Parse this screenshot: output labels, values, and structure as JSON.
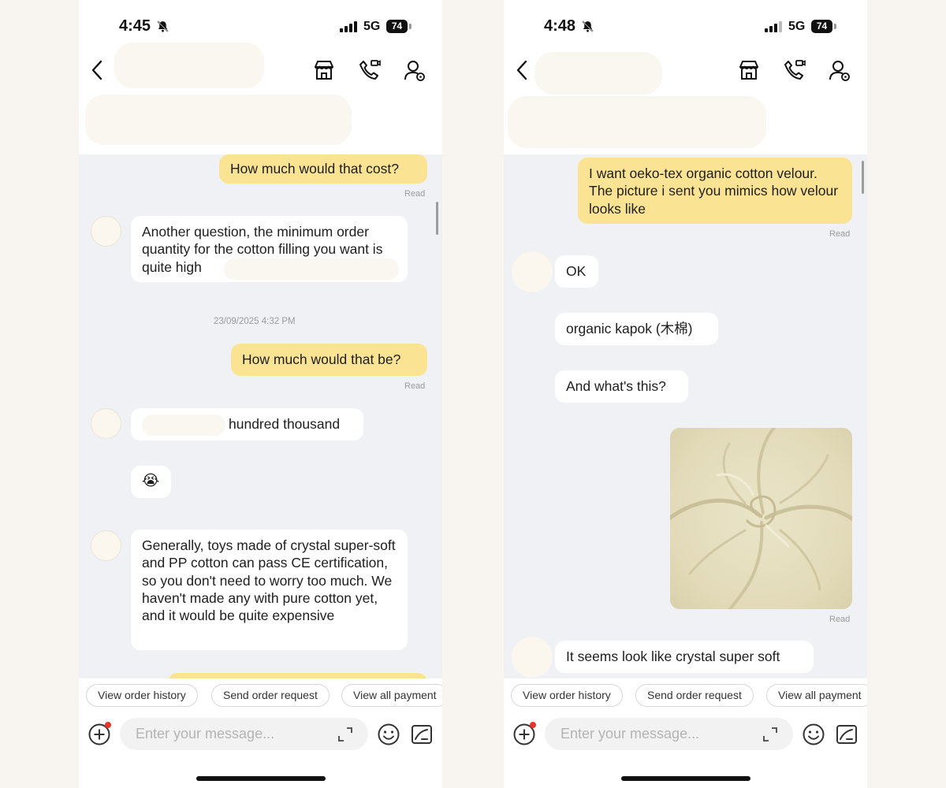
{
  "left": {
    "status": {
      "time": "4:45",
      "network": "5G",
      "battery": "74"
    },
    "messages": {
      "m1": "How much would that cost?",
      "m1_read": "Read",
      "m2": "Another question, the minimum order quantity for the cotton filling you want is quite high",
      "timestamp": "23/09/2025 4:32 PM",
      "m3": "How much would that be?",
      "m3_read": "Read",
      "m4": "hundred thousand",
      "m5_emoji": "😭",
      "m6": "Generally, toys made of crystal super-soft and PP cotton can pass CE certification, so you don't need to worry too much. We haven't made any with pure cotton yet, and it would be quite expensive"
    },
    "chips": [
      "View order history",
      "Send order request",
      "View all payment"
    ],
    "input_placeholder": "Enter your message..."
  },
  "right": {
    "status": {
      "time": "4:48",
      "network": "5G",
      "battery": "74"
    },
    "messages": {
      "m1": "I want oeko-tex organic cotton velour. The picture i sent you mimics how velour looks like",
      "m1_read": "Read",
      "m2": "OK",
      "m3": "organic kapok (木棉)",
      "m4": "And what's this?",
      "img_read": "Read",
      "m5": "It seems look like crystal super soft"
    },
    "chips": [
      "View order history",
      "Send order request",
      "View all payment"
    ],
    "input_placeholder": "Enter your message..."
  },
  "colors": {
    "outgoing_bubble": "#fbe394",
    "incoming_bubble": "#ffffff",
    "chat_background": "#f0f1f5",
    "notification_dot": "#e8352b"
  },
  "icons": [
    "chevron-left-icon",
    "bell-off-icon",
    "store-icon",
    "phone-call-icon",
    "user-settings-icon",
    "plus-circle-icon",
    "expand-icon",
    "emoji-icon",
    "quick-reply-icon"
  ]
}
